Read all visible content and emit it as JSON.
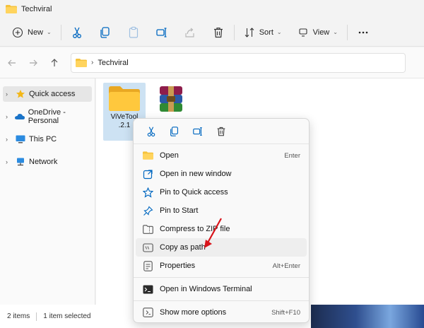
{
  "window": {
    "title": "Techviral"
  },
  "toolbar": {
    "new_label": "New",
    "sort_label": "Sort",
    "view_label": "View"
  },
  "address": {
    "path": "Techviral"
  },
  "sidebar": {
    "items": [
      {
        "label": "Quick access"
      },
      {
        "label": "OneDrive - Personal"
      },
      {
        "label": "This PC"
      },
      {
        "label": "Network"
      }
    ]
  },
  "files": [
    {
      "name": "ViVeTool\n.2.1",
      "icon": "folder-icon"
    },
    {
      "name": "",
      "icon": "winrar-archive-icon"
    }
  ],
  "context_menu": {
    "items": [
      {
        "label": "Open",
        "shortcut": "Enter"
      },
      {
        "label": "Open in new window",
        "shortcut": ""
      },
      {
        "label": "Pin to Quick access",
        "shortcut": ""
      },
      {
        "label": "Pin to Start",
        "shortcut": ""
      },
      {
        "label": "Compress to ZIP file",
        "shortcut": ""
      },
      {
        "label": "Copy as path",
        "shortcut": ""
      },
      {
        "label": "Properties",
        "shortcut": "Alt+Enter"
      },
      {
        "label": "Open in Windows Terminal",
        "shortcut": ""
      },
      {
        "label": "Show more options",
        "shortcut": "Shift+F10"
      }
    ]
  },
  "status": {
    "item_count": "2 items",
    "selection": "1 item selected"
  },
  "colors": {
    "accent": "#0067c0",
    "folder": "#f5c23b",
    "annotation_arrow": "#d9141b"
  }
}
